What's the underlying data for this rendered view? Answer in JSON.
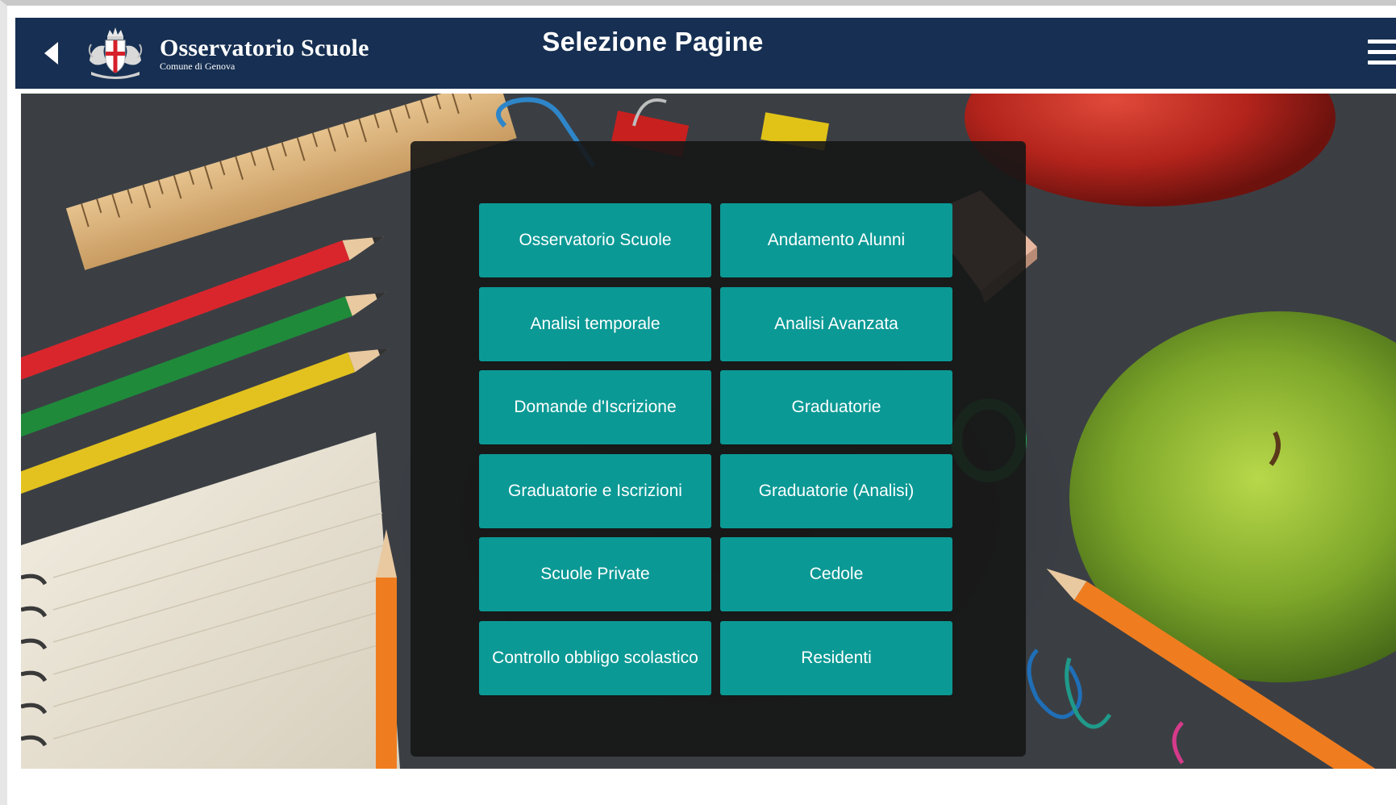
{
  "header": {
    "brand_title": "Osservatorio Scuole",
    "brand_subtitle": "Comune di Genova",
    "page_title": "Selezione Pagine",
    "back_icon": "back-arrow-icon",
    "menu_icon": "hamburger-menu-icon",
    "logo_icon": "genova-coat-of-arms-icon"
  },
  "colors": {
    "header_bg": "#162f52",
    "button_bg": "#0b9995",
    "panel_bg": "#161616"
  },
  "menu": {
    "buttons": [
      {
        "label": "Osservatorio Scuole"
      },
      {
        "label": "Andamento Alunni"
      },
      {
        "label": "Analisi temporale"
      },
      {
        "label": "Analisi Avanzata"
      },
      {
        "label": "Domande d'Iscrizione"
      },
      {
        "label": "Graduatorie"
      },
      {
        "label": "Graduatorie e Iscrizioni"
      },
      {
        "label": "Graduatorie (Analisi)"
      },
      {
        "label": "Scuole Private"
      },
      {
        "label": "Cedole"
      },
      {
        "label": "Controllo obbligo scolastico"
      },
      {
        "label": "Residenti"
      }
    ]
  }
}
